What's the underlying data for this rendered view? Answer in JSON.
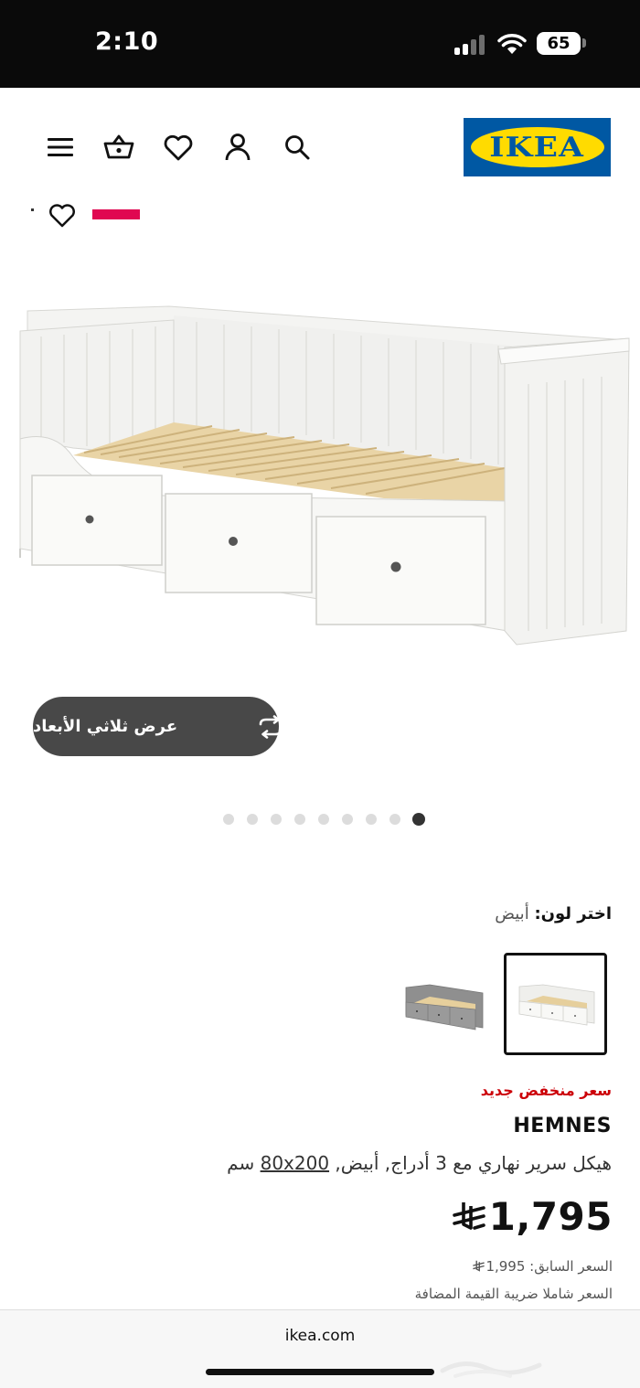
{
  "status_bar": {
    "time": "2:10",
    "battery_level": "65",
    "signal_bars_active": 2
  },
  "nav": {
    "logo_text": "IKEA",
    "icons": [
      "menu-icon",
      "basket-icon",
      "heart-icon",
      "account-icon",
      "search-icon"
    ]
  },
  "product_gallery": {
    "view_3d_label": "عرض ثلاثي الأبعاد",
    "dot_count": 9,
    "active_dot_index": 8
  },
  "color_selector": {
    "title": "اختر لون:",
    "selected_value": "أبيض",
    "swatches": [
      {
        "name": "white",
        "selected": true
      },
      {
        "name": "grey",
        "selected": false
      }
    ]
  },
  "product": {
    "price_label": "سعر منخفض جديد",
    "name": "HEMNES",
    "description": "هيكل سرير نهاري مع 3 أدراج, أبيض,",
    "size_link": "80x200",
    "size_unit": "سم",
    "price": "1,795",
    "previous_price_label": "السعر السابق:",
    "previous_price": "1,995",
    "vat_note": "السعر شاملا ضريبة القيمة المضافة"
  },
  "browser": {
    "url": "ikea.com"
  },
  "colors": {
    "ikea_blue": "#0058a3",
    "ikea_yellow": "#ffdb00",
    "sale_red": "#cc0008",
    "badge_pink": "#e00751",
    "button_dark": "#484848"
  }
}
